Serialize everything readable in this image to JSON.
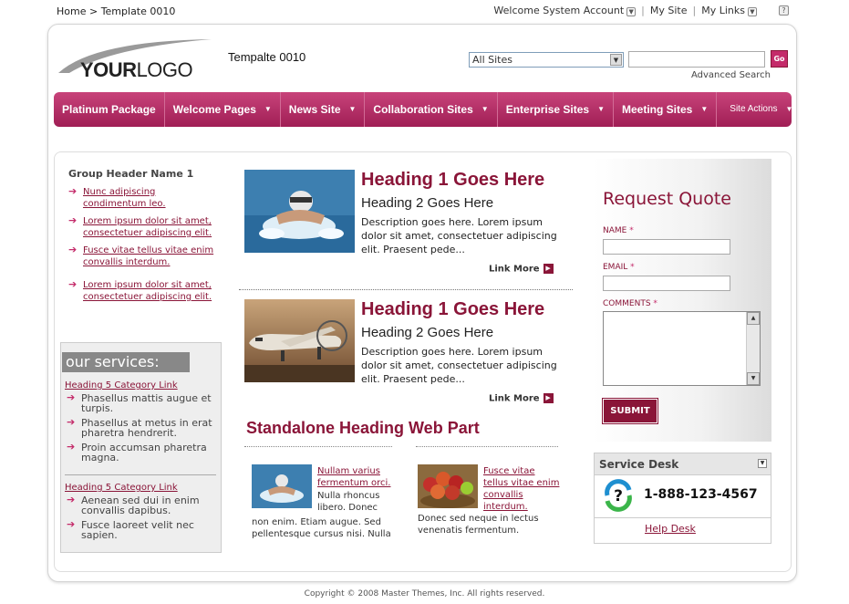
{
  "breadcrumb": "Home > Template 0010",
  "toplinks": {
    "welcome": "Welcome System Account",
    "my_site": "My Site",
    "my_links": "My Links"
  },
  "logo": {
    "bold": "YOUR",
    "normal": "LOGO"
  },
  "site_title": "Tempalte 0010",
  "search": {
    "scope": "All Sites",
    "query": "",
    "go_label": "Go",
    "advanced": "Advanced Search"
  },
  "nav": {
    "items": [
      {
        "label": "Platinum Package",
        "dropdown": false
      },
      {
        "label": "Welcome Pages",
        "dropdown": true
      },
      {
        "label": "News Site",
        "dropdown": true
      },
      {
        "label": "Collaboration Sites",
        "dropdown": true
      },
      {
        "label": "Enterprise Sites",
        "dropdown": true
      },
      {
        "label": "Meeting Sites",
        "dropdown": true
      },
      {
        "label": "Site Actions",
        "dropdown": true
      }
    ]
  },
  "left": {
    "group_header": "Group Header Name 1",
    "links": [
      "Nunc adipiscing condimentum leo.",
      "Lorem ipsum dolor sit amet, consectetuer adipiscing elit.",
      "Fusce vitae tellus vitae enim convallis interdum.",
      "Lorem ipsum dolor sit amet, consectetuer adipiscing elit."
    ],
    "services_title": "our services:",
    "service_blocks": [
      {
        "heading": "Heading 5 Category Link",
        "items": [
          "Phasellus mattis augue et turpis.",
          "Phasellus at metus in erat pharetra hendrerit.",
          "Proin accumsan pharetra magna."
        ]
      },
      {
        "heading": "Heading 5 Category Link",
        "items": [
          "Aenean sed dui in enim convallis dapibus.",
          "Fusce laoreet velit nec sapien."
        ]
      }
    ]
  },
  "articles": [
    {
      "h1": "Heading 1 Goes Here",
      "h2": "Heading 2 Goes Here",
      "desc": "Description goes here. Lorem ipsum dolor sit amet, consectetuer adipiscing elit. Praesent pede...",
      "more": "Link More",
      "image": "swimmer-photo"
    },
    {
      "h1": "Heading 1 Goes Here",
      "h2": "Heading 2 Goes Here",
      "desc": "Description goes here. Lorem ipsum dolor sit amet, consectetuer adipiscing elit. Praesent pede...",
      "more": "Link More",
      "image": "airplane-photo"
    }
  ],
  "standalone": {
    "heading": "Standalone Heading Web Part",
    "items": [
      {
        "link": "Nullam varius fermentum orci.",
        "text_side": "Nulla rhoncus libero. Donec",
        "text_below": "non enim. Etiam augue. Sed pellentesque cursus nisi. Nulla"
      },
      {
        "link": "Fusce vitae tellus vitae enim convallis interdum.",
        "text_below": "Donec sed neque in lectus venenatis fermentum."
      }
    ]
  },
  "quote": {
    "title": "Request Quote",
    "name_label": "NAME",
    "email_label": "EMAIL",
    "comments_label": "COMMENTS",
    "required_mark": "*",
    "submit": "SUBMIT"
  },
  "service_desk": {
    "title": "Service Desk",
    "phone": "1-888-123-4567",
    "link": "Help Desk"
  },
  "footer": "Copyright © 2008 Master Themes, Inc. All rights reserved.",
  "colors": {
    "accent": "#8a1538",
    "nav": "#b52a63"
  }
}
